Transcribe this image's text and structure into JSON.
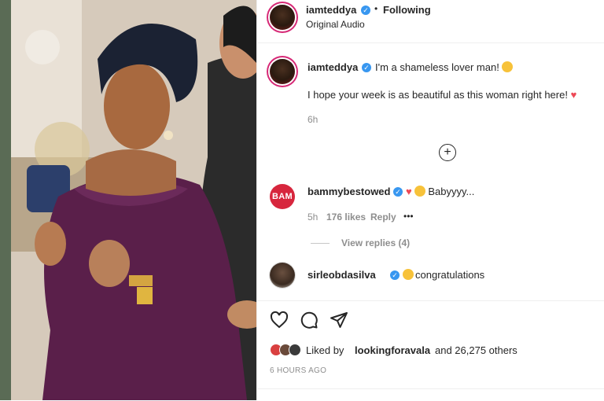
{
  "post": {
    "author": "iamtedd ya",
    "author_handle": "iamteddya",
    "follow_status": "Following",
    "audio": "Original Audio"
  },
  "caption": {
    "author": "iamteddya",
    "line1": "I'm a shameless lover man!",
    "line2": "I hope your week is as beautiful as this woman right here!",
    "time": "6h"
  },
  "comments": [
    {
      "avatar_text": "BAM",
      "author": "bammybestowed",
      "text": "Babyyyy...",
      "time": "5h",
      "likes": "176 likes",
      "reply": "Reply",
      "more": "•••",
      "view_replies": "View replies (4)"
    },
    {
      "author": "sirleobdasilva",
      "text": "congratulations"
    }
  ],
  "likes": {
    "prefix": "Liked by",
    "user": "lookingforavala",
    "suffix": "and 26,275 others"
  },
  "timestamp": "6 HOURS AGO",
  "colors": {
    "verified": "#3897f0",
    "heart": "#ed4956",
    "bam_red": "#d7263d",
    "story_ring": "#d62976"
  },
  "icons": [
    "heart-icon",
    "comment-icon",
    "share-icon",
    "plus-circle-icon",
    "verified-icon"
  ]
}
